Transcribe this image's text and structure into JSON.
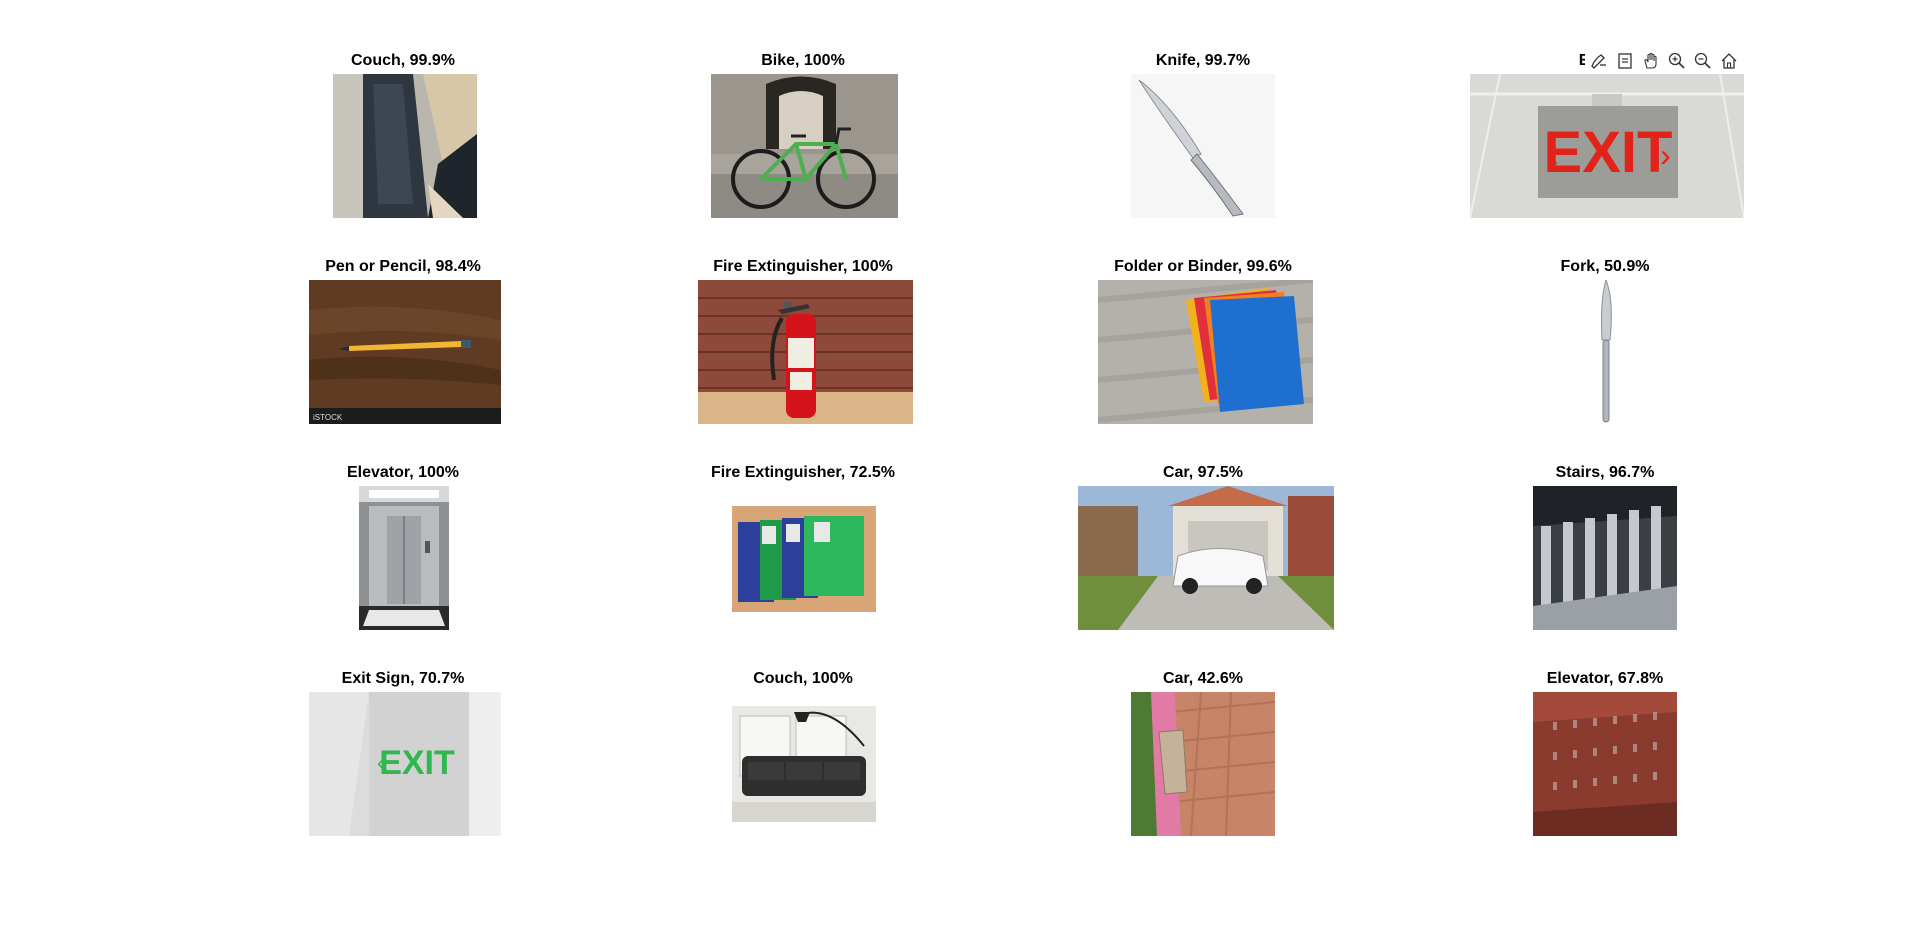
{
  "figure": {
    "panels": [
      {
        "title": "Couch, 99.9%",
        "image": "couch-angled-photo"
      },
      {
        "title": "Bike, 100%",
        "image": "bike-photo"
      },
      {
        "title": "Knife, 99.7%",
        "image": "knife-photo"
      },
      {
        "title": "Exit S",
        "image": "exit-sign-red-photo"
      },
      {
        "title": "Pen or Pencil, 98.4%",
        "image": "pencil-photo"
      },
      {
        "title": "Fire Extinguisher, 100%",
        "image": "fire-extinguisher-photo"
      },
      {
        "title": "Folder or Binder, 99.6%",
        "image": "folders-photo"
      },
      {
        "title": "Fork, 50.9%",
        "image": "knife-vertical-photo"
      },
      {
        "title": "Elevator, 100%",
        "image": "elevator-photo"
      },
      {
        "title": "Fire Extinguisher, 72.5%",
        "image": "binders-photo"
      },
      {
        "title": "Car, 97.5%",
        "image": "car-driveway-photo"
      },
      {
        "title": "Stairs, 96.7%",
        "image": "stairs-photo"
      },
      {
        "title": "Exit Sign, 70.7%",
        "image": "exit-sign-green-photo"
      },
      {
        "title": "Couch, 100%",
        "image": "couch-living-room-photo"
      },
      {
        "title": "Car, 42.6%",
        "image": "brick-path-photo"
      },
      {
        "title": "Elevator, 67.8%",
        "image": "elevator-wall-photo"
      }
    ]
  },
  "toolbar": {
    "buttons": [
      "brush-icon",
      "datatip-icon",
      "pan-hand-icon",
      "zoom-in-icon",
      "zoom-out-icon",
      "home-icon"
    ]
  }
}
